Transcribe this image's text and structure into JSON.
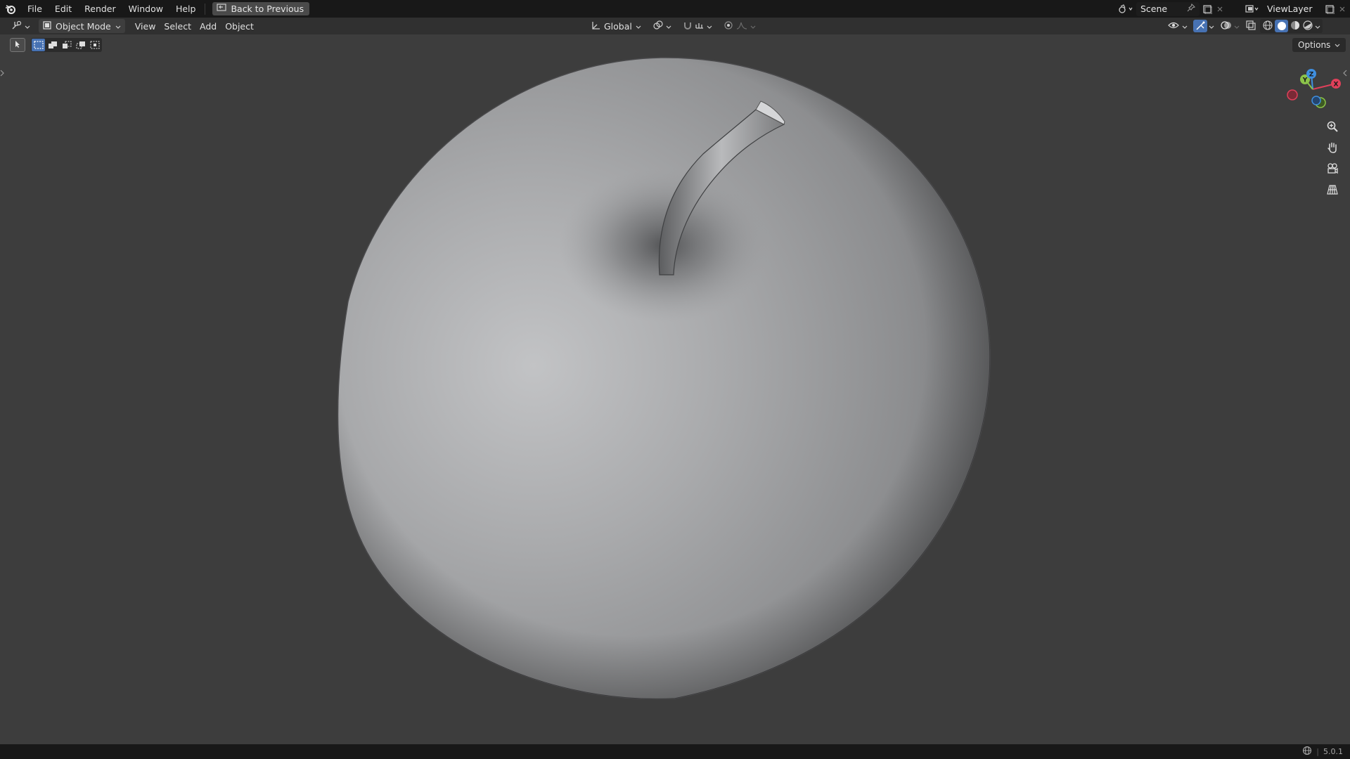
{
  "topbar": {
    "menus": [
      "File",
      "Edit",
      "Render",
      "Window",
      "Help"
    ],
    "back_label": "Back to Previous",
    "scene_name": "Scene",
    "viewlayer_name": "ViewLayer"
  },
  "header": {
    "mode_label": "Object Mode",
    "menus": [
      "View",
      "Select",
      "Add",
      "Object"
    ],
    "transform_orientation": "Global"
  },
  "viewport": {
    "options_label": "Options",
    "gizmo_axes": {
      "x": "X",
      "y": "Y",
      "z": "Z"
    },
    "object": "apple-mesh"
  },
  "statusbar": {
    "version": "5.0.1"
  },
  "colors": {
    "accent": "#4772b3",
    "axis_x": "#e0405a",
    "axis_y": "#8bc34a",
    "axis_z": "#3f8fe0"
  }
}
